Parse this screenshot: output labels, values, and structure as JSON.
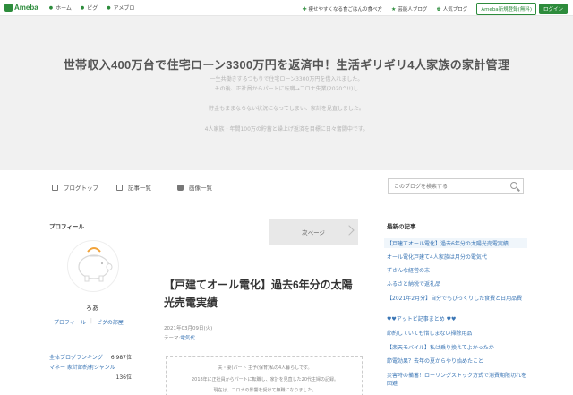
{
  "topbar": {
    "logo_text": "Ameba",
    "nav": [
      {
        "label": "ホーム"
      },
      {
        "label": "ピグ"
      },
      {
        "label": "アメブロ"
      }
    ],
    "promos": [
      {
        "label": "痩せやすくなる食ごはんの食べ方"
      },
      {
        "label": "芸能人ブログ"
      },
      {
        "label": "人気ブログ"
      }
    ],
    "register_label": "Ameba新規登録(無料)",
    "login_label": "ログイン",
    "accent": "#2d8c3c"
  },
  "header": {
    "title": "世帯収入400万台で住宅ローン3300万円を返済中！生活ギリギリ4人家族の家計管理",
    "description": [
      "一生共働きするつもりで住宅ローン3300万円を借入れました。",
      "その後、正社員からパートに転職→コロナ失業(2020^!!)し",
      "貯金もままならない状況になってしまい、家計を見直しました。",
      "4人家族・年間100万の貯蓄と繰上げ返済を目標に日々奮闘中です。"
    ]
  },
  "subnav": {
    "items": [
      {
        "label": "ブログトップ",
        "icon": "page-icon"
      },
      {
        "label": "記事一覧",
        "icon": "list-icon"
      },
      {
        "label": "画像一覧",
        "icon": "camera-icon"
      }
    ],
    "search_placeholder": "このブログを検索する"
  },
  "profile": {
    "heading": "プロフィール",
    "name": "ろあ",
    "links": [
      "プロフィール",
      "ピグの部屋"
    ],
    "rankings": [
      {
        "label": "全体ブログランキング",
        "value": "6,987位"
      },
      {
        "label": "マネー 家計節約術ジャンル",
        "value": "136位"
      }
    ]
  },
  "article": {
    "next_label": "次ページ",
    "title": "【戸建てオール電化】過去6年分の太陽光売電実績",
    "date": "2021年03月09日(火)",
    "theme_prefix": "テーマ:",
    "theme": "電気代",
    "box_lines": [
      "夫・妻(パート 主予(保育)私の4人暮らしです。",
      "2018年に正社員からパートに転職し、家計を見直した20代主婦の記録。",
      "現在は、コロナの影響を受けて無職になりました。"
    ]
  },
  "recent": {
    "heading": "最新の記事",
    "items": [
      "【戸建てオール電化】過去6年分の太陽光売電実績",
      "オール電化戸建て4人家族は月分の電気代",
      "ずさんな経営の末",
      "ふるさと納税で返礼品",
      "【2021年2月分】自分でもびっくりした食費と日用品費",
      "♥♥アットビ記事まとめ ♥♥",
      "節約していても惜しまない掃除用品",
      "【楽天モバイル】私は乗り換えてよかったか",
      "節電効果？去年の夏からやり始めたこと",
      "災害時の備蓄！ローリングストック方式で消費期限切れを回避"
    ]
  }
}
